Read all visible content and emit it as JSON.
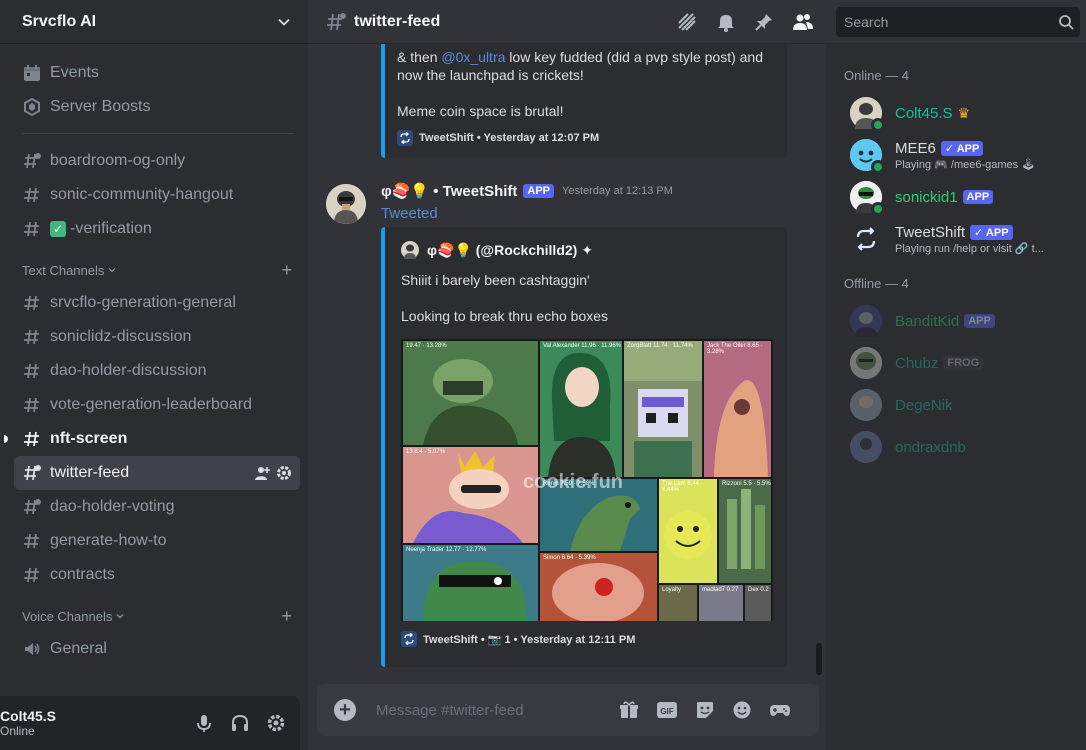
{
  "server": {
    "name": "Srvcflo AI"
  },
  "sidebar": {
    "top_items": [
      {
        "label": "Events",
        "icon": "calendar-icon"
      },
      {
        "label": "Server Boosts",
        "icon": "boost-icon"
      }
    ],
    "pinned_channels": [
      {
        "label": "boardroom-og-only"
      },
      {
        "label": "sonic-community-hangout"
      },
      {
        "label": "-verification",
        "emoji": "✓"
      }
    ],
    "text_category": "Text Channels",
    "text_channels": [
      {
        "label": "srvcflo-generation-general"
      },
      {
        "label": "soniclidz-discussion"
      },
      {
        "label": "dao-holder-discussion"
      },
      {
        "label": "vote-generation-leaderboard"
      },
      {
        "label": "nft-screen"
      },
      {
        "label": "twitter-feed"
      },
      {
        "label": "dao-holder-voting"
      },
      {
        "label": "generate-how-to"
      },
      {
        "label": "contracts"
      }
    ],
    "voice_category": "Voice Channels",
    "voice_channels": [
      {
        "label": "General"
      }
    ]
  },
  "user_panel": {
    "name": "Colt45.S",
    "status": "Online"
  },
  "topbar": {
    "channel": "twitter-feed",
    "search_placeholder": "Search"
  },
  "messages": {
    "first_embed": {
      "line1_prefix": "& then ",
      "line1_mention": "@0x_ultra",
      "line1_suffix": " low key fudded (did a pvp style post) and",
      "line2": "now the launchpad is crickets!",
      "line3": "Meme coin space is brutal!",
      "footer": "TweetShift • Yesterday at 12:07 PM"
    },
    "second": {
      "author_prefix": "φ🍣💡 • ",
      "author": "TweetShift",
      "badge": "APP",
      "time": "Yesterday at 12:13 PM",
      "tweeted": "Tweeted",
      "embed_author": "φ🍣💡 (@Rockchilld2) ✦",
      "text1": "Shiiit i barely been cashtaggin'",
      "text2": "Looking to break thru echo boxes",
      "watermark": "cookie.fun",
      "footer": "TweetShift • 📷 1 • Yesterday at 12:11 PM",
      "tiles": [
        {
          "label": "19.47 · 13.28%"
        },
        {
          "label": "Val Alexander  11.96 · 11.96%"
        },
        {
          "label": "ZorgBlatt  11.74 · 11.74%"
        },
        {
          "label": "Jack The Oiler  8.65 · 3.28%"
        },
        {
          "label": "13  8.4 · 5.07%"
        },
        {
          "label": "Ronin  7.59 · 7.58%"
        },
        {
          "label": "The Lam  6.44 · 6.44%"
        },
        {
          "label": "Rizzoni  5.5 · 5.5%"
        },
        {
          "label": "Neenja Trader  12.77 · 12.77%"
        },
        {
          "label": "Simon  6.64 · 5.39%"
        },
        {
          "label": "Loyalty"
        },
        {
          "label": "madlad7  0.27"
        },
        {
          "label": "Dex  0.2"
        }
      ]
    }
  },
  "composer": {
    "placeholder": "Message #twitter-feed"
  },
  "members": {
    "online_header": "Online — 4",
    "online": [
      {
        "name": "Colt45.S",
        "color": "#1abc9c",
        "crown": "♛"
      },
      {
        "name": "MEE6",
        "color": "#dbdee1",
        "badge": "✓ APP",
        "sub": "Playing 🎮 /mee6-games 🕹"
      },
      {
        "name": "sonickid1",
        "color": "#2ecc71",
        "badge": "APP"
      },
      {
        "name": "TweetShift",
        "color": "#dbdee1",
        "badge": "✓ APP",
        "sub": "Playing run /help or visit 🔗 t..."
      }
    ],
    "offline_header": "Offline — 4",
    "offline": [
      {
        "name": "BanditKid",
        "color": "#2ecc71",
        "badge": "APP"
      },
      {
        "name": "Chubz",
        "color": "#1abc9c",
        "tag": "FROG"
      },
      {
        "name": "DegeNik",
        "color": "#1abc9c"
      },
      {
        "name": "ondraxdnb",
        "color": "#1abc9c"
      }
    ]
  },
  "colors": {
    "accent": "#5865f2",
    "link": "#5b8bd9",
    "twitter_bar": "#1d9bf0",
    "online": "#23a55a"
  }
}
